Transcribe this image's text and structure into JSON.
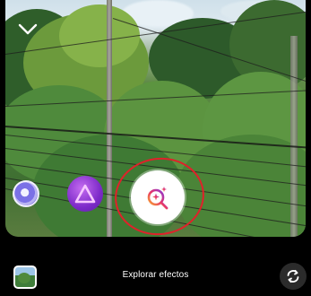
{
  "camera": {
    "collapse_icon": "chevron-down-icon",
    "effects": [
      {
        "name": "effect-bubble-icon"
      },
      {
        "name": "neon-triangle-effect-icon"
      }
    ],
    "capture": {
      "icon": "search-sparkle-icon"
    },
    "highlight_color": "#e0212a"
  },
  "bottom_bar": {
    "explore_label": "Explorar efectos",
    "gallery_icon": "gallery-thumbnail",
    "flip_icon": "camera-flip-icon"
  }
}
